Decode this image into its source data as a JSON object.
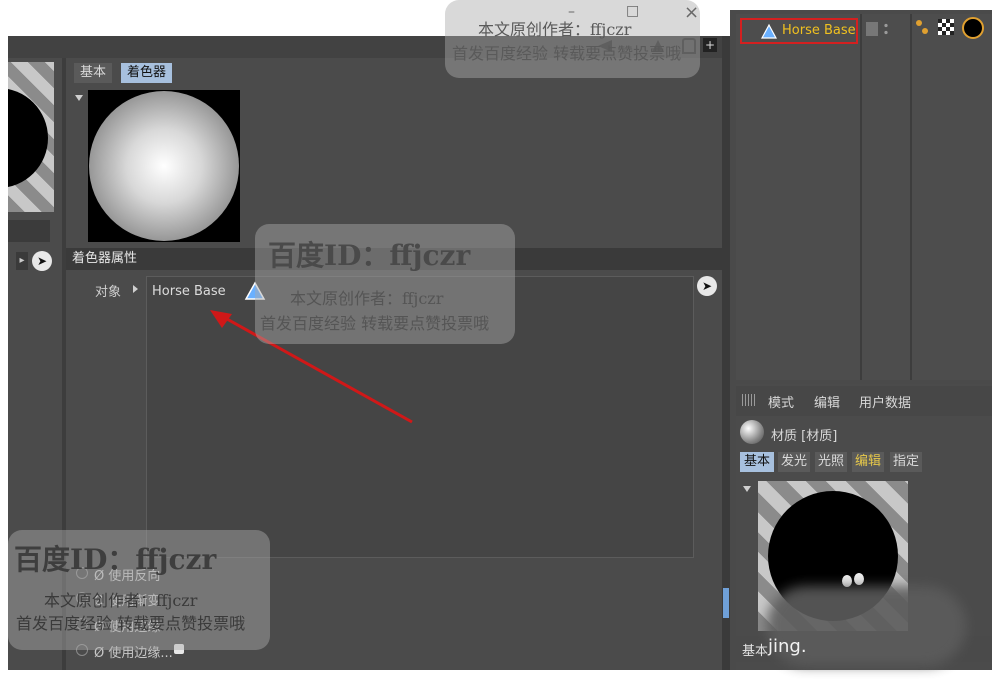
{
  "window": {
    "minimize_glyph": "–",
    "maximize_glyph": "□",
    "close_glyph": "×"
  },
  "left_tabs": {
    "basic": "基本",
    "shader": "着色器"
  },
  "shader_section": {
    "header": "着色器属性",
    "object_label": "对象",
    "object_value": "Horse Base"
  },
  "options": [
    "Ø 使用反向",
    "Ø 使用渐变",
    "Ø 使用边缘",
    "Ø 使用边缘..."
  ],
  "object_tree": {
    "item_label": "Horse Base"
  },
  "attr_menu": {
    "mode": "模式",
    "edit": "编辑",
    "user_data": "用户数据"
  },
  "material": {
    "title": "材质 [材质]",
    "tabs": [
      "基本",
      "发光",
      "光照",
      "编辑",
      "指定"
    ],
    "bottom_label": "基本",
    "bottom_text": "jing."
  },
  "watermarks": {
    "id_line": "百度ID：ffjczr",
    "author_line": "本文原创作者：ffjczr",
    "promo_line": "首发百度经验 转载要点赞投票哦"
  },
  "colors": {
    "highlight_border": "#d42020",
    "arrow": "#d01818",
    "tab_active": "#a7c0de",
    "tab_edit": "#e6c84a",
    "object_label": "#f0c020"
  }
}
